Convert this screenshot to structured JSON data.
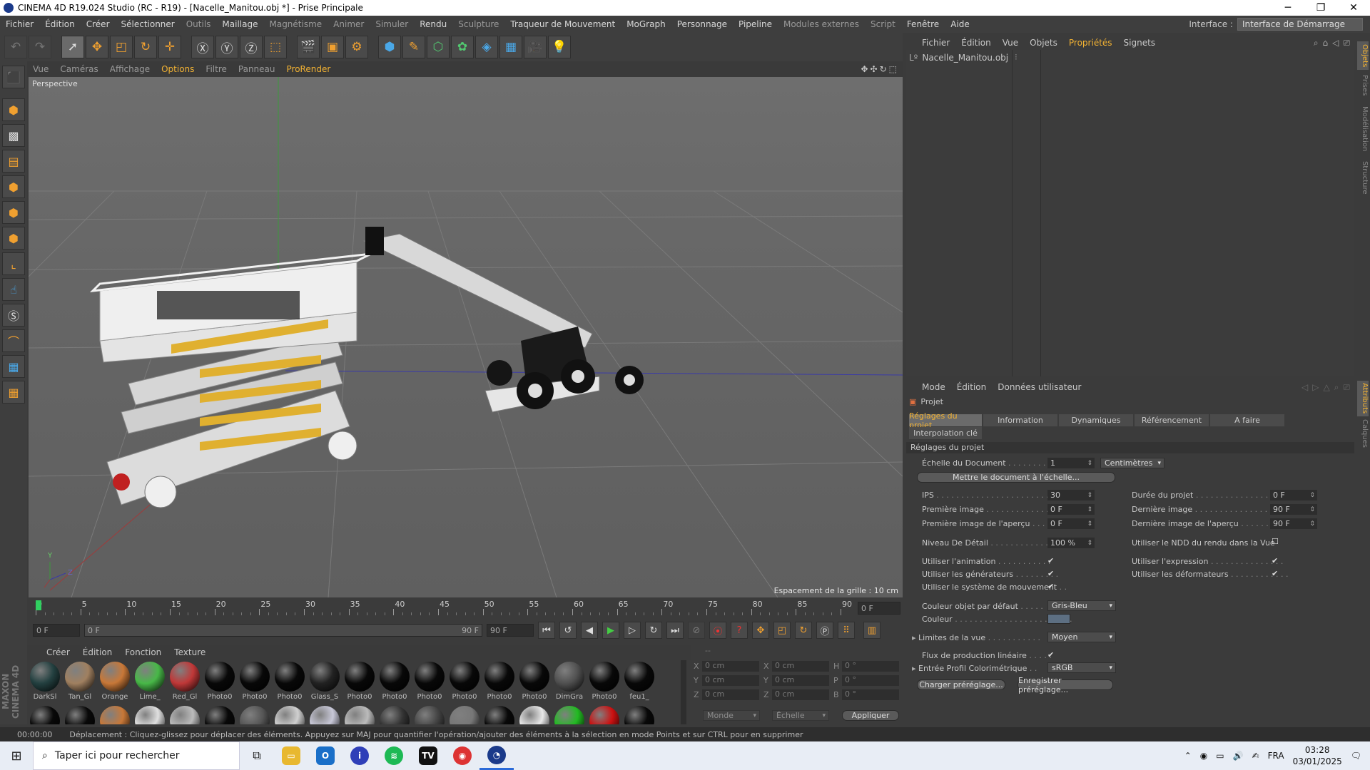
{
  "window": {
    "title": "CINEMA 4D R19.024 Studio (RC - R19) - [Nacelle_Manitou.obj *] - Prise Principale",
    "min": "─",
    "max": "❐",
    "close": "✕"
  },
  "menu": {
    "items": [
      {
        "label": "Fichier",
        "style": "normal"
      },
      {
        "label": "Édition",
        "style": "normal"
      },
      {
        "label": "Créer",
        "style": "normal"
      },
      {
        "label": "Sélectionner",
        "style": "normal"
      },
      {
        "label": "Outils",
        "style": "dim"
      },
      {
        "label": "Maillage",
        "style": "normal"
      },
      {
        "label": "Magnétisme",
        "style": "dim"
      },
      {
        "label": "Animer",
        "style": "dim"
      },
      {
        "label": "Simuler",
        "style": "dim"
      },
      {
        "label": "Rendu",
        "style": "normal"
      },
      {
        "label": "Sculpture",
        "style": "dim"
      },
      {
        "label": "Traqueur de Mouvement",
        "style": "normal"
      },
      {
        "label": "MoGraph",
        "style": "normal"
      },
      {
        "label": "Personnage",
        "style": "normal"
      },
      {
        "label": "Pipeline",
        "style": "normal"
      },
      {
        "label": "Modules externes",
        "style": "dim"
      },
      {
        "label": "Script",
        "style": "dim"
      },
      {
        "label": "Fenêtre",
        "style": "normal"
      },
      {
        "label": "Aide",
        "style": "normal"
      }
    ],
    "interface_label": "Interface :",
    "interface_value": "Interface de Démarrage"
  },
  "viewport": {
    "menu": [
      "Vue",
      "Caméras",
      "Affichage",
      "Options",
      "Filtre",
      "Panneau",
      "ProRender"
    ],
    "camera": "Perspective",
    "grid_spacing": "Espacement de la grille : 10 cm",
    "axis_y": "Y",
    "axis_z": "Z"
  },
  "timeline": {
    "ticks": [
      "0",
      "5",
      "10",
      "15",
      "20",
      "25",
      "30",
      "35",
      "40",
      "45",
      "50",
      "55",
      "60",
      "65",
      "70",
      "75",
      "80",
      "85",
      "90"
    ],
    "current": "0 F",
    "start": "0 F",
    "range_start": "0 F",
    "range_end": "90 F",
    "end": "90 F"
  },
  "materials": {
    "menu": [
      "Créer",
      "Édition",
      "Fonction",
      "Texture"
    ],
    "row1": [
      {
        "name": "DarkSl",
        "color": "#234040"
      },
      {
        "name": "Tan_Gl",
        "color": "#a08060"
      },
      {
        "name": "Orange",
        "color": "#c87838"
      },
      {
        "name": "Lime_",
        "color": "#48b848"
      },
      {
        "name": "Red_Gl",
        "color": "#c03838"
      },
      {
        "name": "Photo0",
        "color": "#080808"
      },
      {
        "name": "Photo0",
        "color": "#080808"
      },
      {
        "name": "Photo0",
        "color": "#080808"
      },
      {
        "name": "Glass_S",
        "color": "#222222"
      },
      {
        "name": "Photo0",
        "color": "#080808"
      },
      {
        "name": "Photo0",
        "color": "#080808"
      },
      {
        "name": "Photo0",
        "color": "#080808"
      },
      {
        "name": "Photo0",
        "color": "#080808"
      },
      {
        "name": "Photo0",
        "color": "#080808"
      },
      {
        "name": "Photo0",
        "color": "#080808"
      },
      {
        "name": "DimGra",
        "color": "#505050"
      },
      {
        "name": "Photo0",
        "color": "#080808"
      },
      {
        "name": "feu1_",
        "color": "#080808"
      }
    ],
    "row2": [
      "#080808",
      "#080808",
      "#c87838",
      "#e0e0e0",
      "#bbbbbb",
      "#080808",
      "#555555",
      "#d0d0d0",
      "#c8c8d8",
      "#bbbbbb",
      "#333333",
      "#444444",
      "#777777",
      "#080808",
      "#e8e8e8",
      "#22bb22",
      "#cc1111",
      "#080808"
    ]
  },
  "coords": {
    "rows": [
      [
        "X",
        "0 cm",
        "X",
        "0 cm",
        "H",
        "0 °"
      ],
      [
        "Y",
        "0 cm",
        "Y",
        "0 cm",
        "P",
        "0 °"
      ],
      [
        "Z",
        "0 cm",
        "Z",
        "0 cm",
        "B",
        "0 °"
      ]
    ],
    "top": "--",
    "space": "Monde",
    "mode": "Échelle",
    "apply": "Appliquer"
  },
  "objects": {
    "menu": [
      "Fichier",
      "Édition",
      "Vue",
      "Objets",
      "Propriétés",
      "Signets"
    ],
    "items": [
      {
        "name": "Nacelle_Manitou.obj"
      }
    ]
  },
  "attributes": {
    "menu": [
      "Mode",
      "Édition",
      "Données utilisateur"
    ],
    "header": "Projet",
    "tabs": [
      "Réglages du projet",
      "Information",
      "Dynamiques",
      "Référencement",
      "A faire",
      "Interpolation clé"
    ],
    "section": "Réglages du projet",
    "doc_scale_label": "Échelle du Document",
    "doc_scale": "1",
    "doc_unit": "Centimètres",
    "scale_btn": "Mettre le document à l'échelle...",
    "fps_label": "IPS",
    "fps": "30",
    "duration_label": "Durée du projet",
    "duration": "0 F",
    "first_label": "Première image",
    "first": "0 F",
    "last_label": "Dernière image",
    "last": "90 F",
    "pfirst_label": "Première image de l'aperçu",
    "pfirst": "0 F",
    "plast_label": "Dernière image de l'aperçu",
    "plast": "90 F",
    "lod_label": "Niveau De Détail",
    "lod": "100 %",
    "ndd_label": "Utiliser le NDD du rendu dans la Vue",
    "anim_label": "Utiliser l'animation",
    "expr_label": "Utiliser l'expression",
    "gen_label": "Utiliser les générateurs",
    "def_label": "Utiliser les déformateurs",
    "motion_label": "Utiliser le système de mouvement",
    "objcolor_label": "Couleur objet par défaut",
    "objcolor": "Gris-Bleu",
    "color_label": "Couleur",
    "limits_label": "Limites de la vue",
    "limits": "Moyen",
    "linear_label": "Flux de production linéaire",
    "profile_label": "Entrée Profil Colorimétrique",
    "profile": "sRGB",
    "load_btn": "Charger préréglage...",
    "save_btn": "Enregistrer préréglage..."
  },
  "right_tabs": [
    "Objets",
    "Prises",
    "Modélisation",
    "Structure",
    "Attributs",
    "Calques"
  ],
  "status": {
    "time": "00:00:00",
    "message": "Déplacement : Cliquez-glissez pour déplacer des éléments. Appuyez sur MAJ pour quantifier l'opération/ajouter des éléments à la sélection en mode Points et sur CTRL pour en supprimer"
  },
  "taskbar": {
    "search": "Taper ici pour rechercher",
    "lang": "FRA",
    "time": "03:28",
    "date": "03/01/2025"
  }
}
